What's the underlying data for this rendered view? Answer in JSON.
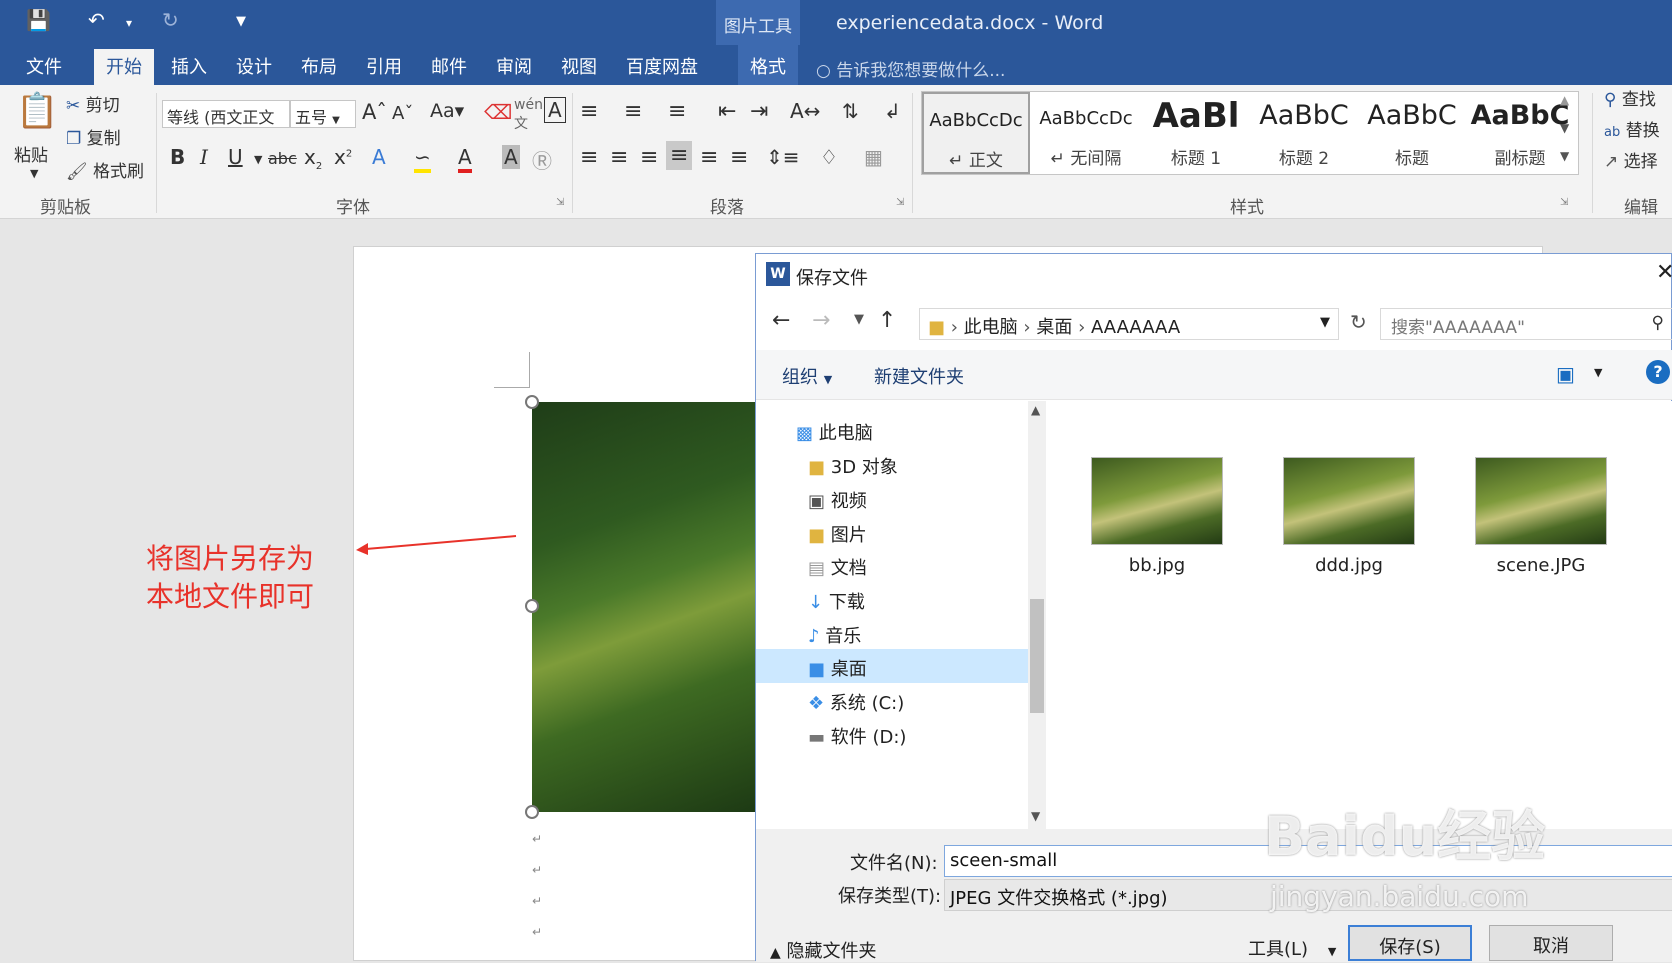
{
  "titlebar": {
    "context_tool": "图片工具",
    "document_title": "experiencedata.docx - Word"
  },
  "tabs": [
    "文件",
    "开始",
    "插入",
    "设计",
    "布局",
    "引用",
    "邮件",
    "审阅",
    "视图",
    "百度网盘",
    "格式"
  ],
  "tell_me": "告诉我您想要做什么...",
  "ribbon": {
    "clipboard": {
      "paste": "粘贴",
      "cut": "剪切",
      "copy": "复制",
      "format_painter": "格式刷",
      "label": "剪贴板"
    },
    "font": {
      "font_name": "等线 (西文正文",
      "font_size": "五号",
      "label": "字体"
    },
    "paragraph": {
      "label": "段落"
    },
    "styles": {
      "label": "样式",
      "items": [
        {
          "preview": "AaBbCcDc",
          "name": "正文"
        },
        {
          "preview": "AaBbCcDc",
          "name": "无间隔"
        },
        {
          "preview": "AaBl",
          "name": "标题 1"
        },
        {
          "preview": "AaBbC",
          "name": "标题 2"
        },
        {
          "preview": "AaBbC",
          "name": "标题"
        },
        {
          "preview": "AaBbC",
          "name": "副标题"
        }
      ]
    },
    "editing": {
      "find": "查找",
      "replace": "替换",
      "select": "选择",
      "label": "编辑"
    }
  },
  "annotation": {
    "line1": "将图片另存为",
    "line2": "本地文件即可"
  },
  "dialog": {
    "title": "保存文件",
    "breadcrumb": [
      "此电脑",
      "桌面",
      "AAAAAAA"
    ],
    "search_placeholder": "搜索\"AAAAAAA\"",
    "organize": "组织",
    "new_folder": "新建文件夹",
    "nav_items": [
      "此电脑",
      "3D 对象",
      "视频",
      "图片",
      "文档",
      "下载",
      "音乐",
      "桌面",
      "系统 (C:)",
      "软件 (D:)"
    ],
    "files": [
      "bb.jpg",
      "ddd.jpg",
      "scene.JPG"
    ],
    "filename_label": "文件名(N):",
    "filename_value": "sceen-small",
    "filetype_label": "保存类型(T):",
    "filetype_value": "JPEG 文件交换格式 (*.jpg)",
    "hide_folders": "隐藏文件夹",
    "tools": "工具(L)",
    "save": "保存(S)",
    "cancel": "取消"
  },
  "watermark": {
    "brand": "Baidu经验",
    "url": "jingyan.baidu.com"
  }
}
